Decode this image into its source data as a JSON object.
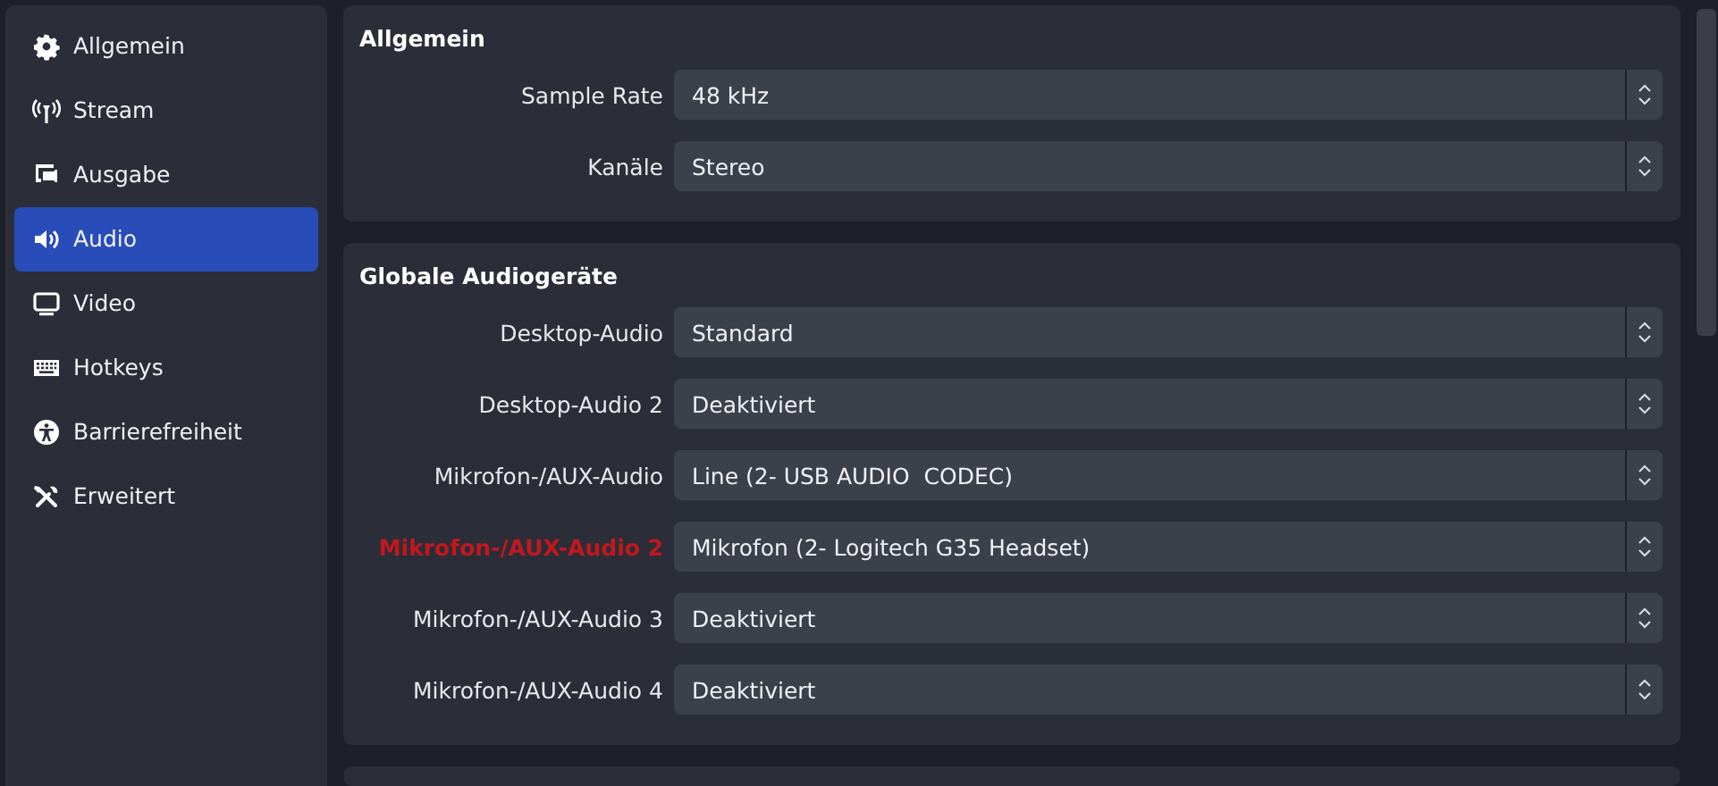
{
  "sidebar": {
    "items": [
      {
        "label": "Allgemein",
        "kind": "gear",
        "selected": false
      },
      {
        "label": "Stream",
        "kind": "antenna",
        "selected": false
      },
      {
        "label": "Ausgabe",
        "kind": "output",
        "selected": false
      },
      {
        "label": "Audio",
        "kind": "speaker",
        "selected": true
      },
      {
        "label": "Video",
        "kind": "monitor",
        "selected": false
      },
      {
        "label": "Hotkeys",
        "kind": "keyboard",
        "selected": false
      },
      {
        "label": "Barrierefreiheit",
        "kind": "accessibility",
        "selected": false
      },
      {
        "label": "Erweitert",
        "kind": "tools",
        "selected": false
      }
    ]
  },
  "groups": [
    {
      "title": "Allgemein",
      "rows": [
        {
          "label": "Sample Rate",
          "value": "48 kHz",
          "highlighted": false
        },
        {
          "label": "Kanäle",
          "value": "Stereo",
          "highlighted": false
        }
      ]
    },
    {
      "title": "Globale Audiogeräte",
      "rows": [
        {
          "label": "Desktop-Audio",
          "value": "Standard",
          "highlighted": false
        },
        {
          "label": "Desktop-Audio 2",
          "value": "Deaktiviert",
          "highlighted": false
        },
        {
          "label": "Mikrofon-/AUX-Audio",
          "value": "Line (2- USB AUDIO  CODEC)",
          "highlighted": false
        },
        {
          "label": "Mikrofon-/AUX-Audio 2",
          "value": "Mikrofon (2- Logitech G35 Headset)",
          "highlighted": true
        },
        {
          "label": "Mikrofon-/AUX-Audio 3",
          "value": "Deaktiviert",
          "highlighted": false
        },
        {
          "label": "Mikrofon-/AUX-Audio 4",
          "value": "Deaktiviert",
          "highlighted": false
        }
      ]
    }
  ]
}
